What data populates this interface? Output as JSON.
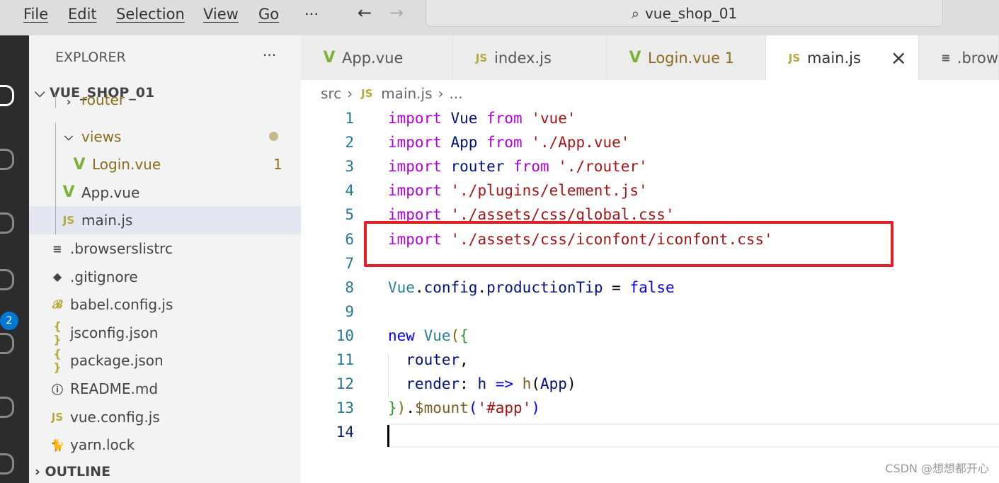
{
  "menu": [
    "File",
    "Edit",
    "Selection",
    "View",
    "Go",
    "···"
  ],
  "nav": {
    "back": "←",
    "forward": "→"
  },
  "search": {
    "icon": "search-icon",
    "text": "vue_shop_01"
  },
  "activity": {
    "badge": "2"
  },
  "explorer": {
    "title": "EXPLORER",
    "more": "···",
    "root": "VUE_SHOP_01",
    "outline": "OUTLINE",
    "items": [
      {
        "label": "router",
        "icon": "chevron-right",
        "indent": 1
      },
      {
        "label": "views",
        "icon": "chevron-down",
        "indent": 1,
        "modified": true
      },
      {
        "label": "Login.vue",
        "icon": "vue",
        "indent": 2,
        "badge": "1"
      },
      {
        "label": "App.vue",
        "icon": "vue",
        "indent": 1
      },
      {
        "label": "main.js",
        "icon": "js",
        "indent": 1,
        "selected": true
      },
      {
        "label": ".browserslistrc",
        "icon": "lines",
        "indent": 0
      },
      {
        "label": ".gitignore",
        "icon": "git",
        "indent": 0
      },
      {
        "label": "babel.config.js",
        "icon": "babel",
        "indent": 0
      },
      {
        "label": "jsconfig.json",
        "icon": "json",
        "indent": 0
      },
      {
        "label": "package.json",
        "icon": "json",
        "indent": 0
      },
      {
        "label": "README.md",
        "icon": "info",
        "indent": 0
      },
      {
        "label": "vue.config.js",
        "icon": "js",
        "indent": 0
      },
      {
        "label": "yarn.lock",
        "icon": "yarn",
        "indent": 0
      }
    ]
  },
  "tabs": [
    {
      "label": "App.vue",
      "icon": "vue"
    },
    {
      "label": "index.js",
      "icon": "js"
    },
    {
      "label": "Login.vue 1",
      "icon": "vue",
      "modified": true
    },
    {
      "label": "main.js",
      "icon": "js",
      "active": true,
      "close": "×"
    },
    {
      "label": ".brow",
      "icon": "lines"
    }
  ],
  "breadcrumb": [
    "src",
    "main.js",
    "..."
  ],
  "code": [
    [
      [
        "import ",
        "k"
      ],
      [
        "Vue ",
        "v"
      ],
      [
        "from ",
        "k"
      ],
      [
        "'vue'",
        "s"
      ]
    ],
    [
      [
        "import ",
        "k"
      ],
      [
        "App ",
        "v"
      ],
      [
        "from ",
        "k"
      ],
      [
        "'./App.vue'",
        "s"
      ]
    ],
    [
      [
        "import ",
        "k"
      ],
      [
        "router ",
        "v"
      ],
      [
        "from ",
        "k"
      ],
      [
        "'./router'",
        "s"
      ]
    ],
    [
      [
        "import ",
        "k"
      ],
      [
        "'./plugins/element.js'",
        "s"
      ]
    ],
    [
      [
        "import ",
        "k"
      ],
      [
        "'./assets/css/global.css'",
        "s"
      ]
    ],
    [
      [
        "import ",
        "k"
      ],
      [
        "'./assets/css/iconfont/iconfont.css'",
        "s"
      ]
    ],
    [],
    [
      [
        "Vue",
        "t"
      ],
      [
        ".",
        ""
      ],
      [
        "config",
        "v"
      ],
      [
        ".",
        ""
      ],
      [
        "productionTip",
        "v"
      ],
      [
        " = ",
        ""
      ],
      [
        "false",
        "b"
      ]
    ],
    [],
    [
      [
        "new ",
        "b"
      ],
      [
        "Vue",
        "t"
      ],
      [
        "(",
        "y"
      ],
      [
        "{",
        "g"
      ]
    ],
    [
      [
        "  router",
        "v"
      ],
      [
        ",",
        ""
      ]
    ],
    [
      [
        "  render",
        "v"
      ],
      [
        ": ",
        ""
      ],
      [
        "h ",
        "v"
      ],
      [
        "=> ",
        "b"
      ],
      [
        "h",
        "f"
      ],
      [
        "(",
        ""
      ],
      [
        "App",
        "v"
      ],
      [
        ")",
        ""
      ]
    ],
    [
      [
        "}",
        "g"
      ],
      [
        ")",
        "y"
      ],
      [
        ".",
        ""
      ],
      [
        "$mount",
        "f"
      ],
      [
        "(",
        "b"
      ],
      [
        "'#app'",
        "s"
      ],
      [
        ")",
        "b"
      ]
    ],
    []
  ],
  "watermark": "CSDN @想想都开心"
}
